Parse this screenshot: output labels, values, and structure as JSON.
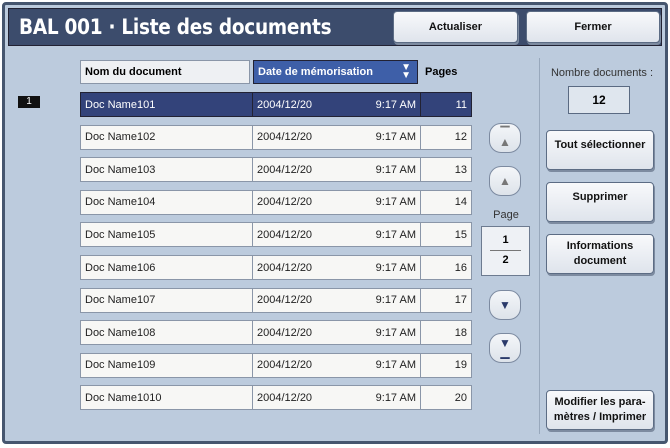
{
  "title": "BAL 001 · Liste des documents",
  "buttons": {
    "refresh": "Actualiser",
    "close": "Fermer",
    "select_all": "Tout sélectionner",
    "delete": "Supprimer",
    "info": "Informations document",
    "modify": "Modifier les para-mètres / Imprimer"
  },
  "columns": {
    "name": "Nom du document",
    "date": "Date de mémorisation",
    "pages": "Pages"
  },
  "selected_index": "1",
  "rows": [
    {
      "name": "Doc Name101",
      "date": "2004/12/20",
      "time": "9:17 AM",
      "pages": "11"
    },
    {
      "name": "Doc Name102",
      "date": "2004/12/20",
      "time": "9:17 AM",
      "pages": "12"
    },
    {
      "name": "Doc Name103",
      "date": "2004/12/20",
      "time": "9:17 AM",
      "pages": "13"
    },
    {
      "name": "Doc Name104",
      "date": "2004/12/20",
      "time": "9:17 AM",
      "pages": "14"
    },
    {
      "name": "Doc Name105",
      "date": "2004/12/20",
      "time": "9:17 AM",
      "pages": "15"
    },
    {
      "name": "Doc Name106",
      "date": "2004/12/20",
      "time": "9:17 AM",
      "pages": "16"
    },
    {
      "name": "Doc Name107",
      "date": "2004/12/20",
      "time": "9:17 AM",
      "pages": "17"
    },
    {
      "name": "Doc Name108",
      "date": "2004/12/20",
      "time": "9:17 AM",
      "pages": "18"
    },
    {
      "name": "Doc Name109",
      "date": "2004/12/20",
      "time": "9:17 AM",
      "pages": "19"
    },
    {
      "name": "Doc Name1010",
      "date": "2004/12/20",
      "time": "9:17 AM",
      "pages": "20"
    }
  ],
  "pager": {
    "label": "Page",
    "current": "1",
    "total": "2"
  },
  "count": {
    "label": "Nombre documents :",
    "value": "12"
  }
}
